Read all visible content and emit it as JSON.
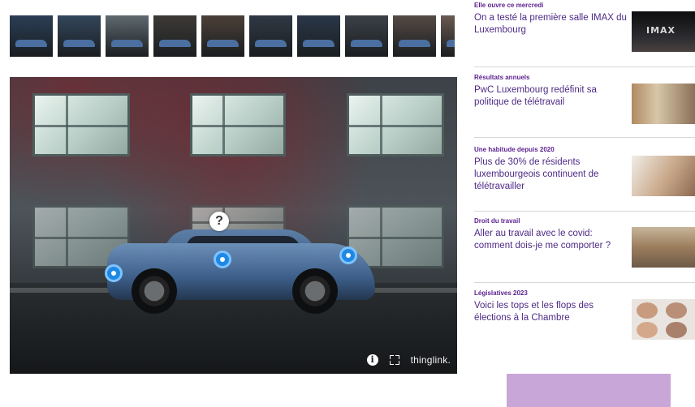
{
  "thumbnails": [
    {
      "label": "thumb-1",
      "active": true,
      "bg": "#2b3e55"
    },
    {
      "label": "thumb-2",
      "active": false,
      "bg": "#33465b"
    },
    {
      "label": "thumb-3",
      "active": false,
      "bg": "#5f6a70"
    },
    {
      "label": "thumb-4",
      "active": false,
      "bg": "#3d3a36"
    },
    {
      "label": "thumb-5",
      "active": false,
      "bg": "#4c4038"
    },
    {
      "label": "thumb-6",
      "active": false,
      "bg": "#2f3944"
    },
    {
      "label": "thumb-7",
      "active": false,
      "bg": "#2a3848"
    },
    {
      "label": "thumb-8",
      "active": false,
      "bg": "#3b4148"
    },
    {
      "label": "thumb-9",
      "active": false,
      "bg": "#554a44"
    },
    {
      "label": "thumb-10",
      "active": false,
      "bg": "#6a5a52"
    }
  ],
  "viewer": {
    "question_mark": "?",
    "info_symbol": "i",
    "brand": "thinglink."
  },
  "articles": [
    {
      "category": "Elle ouvre ce mercredi",
      "title": "On a testé la première salle IMAX du Luxembourg",
      "image_text": "IMAX",
      "image": "imax"
    },
    {
      "category": "Résultats annuels",
      "title": "PwC Luxembourg redéfinit sa politique de télétravail",
      "image": "office"
    },
    {
      "category": "Une habitude depuis 2020",
      "title": "Plus de 30% de résidents luxembourgeois continuent de télétravailler",
      "image": "home"
    },
    {
      "category": "Droit du travail",
      "title": "Aller au travail avec le covid: comment dois-je me comporter ?",
      "image": "warehouse"
    },
    {
      "category": "Législatives 2023",
      "title": "Voici les tops et les flops des élections à la Chambre",
      "image": "faces"
    }
  ],
  "colors": {
    "accent_teal": "#2cc7c0",
    "hotspot_blue": "#1e88e5",
    "article_title": "#4e2a86",
    "article_category": "#5b1f8f",
    "ad_box": "#c8a6d8"
  }
}
